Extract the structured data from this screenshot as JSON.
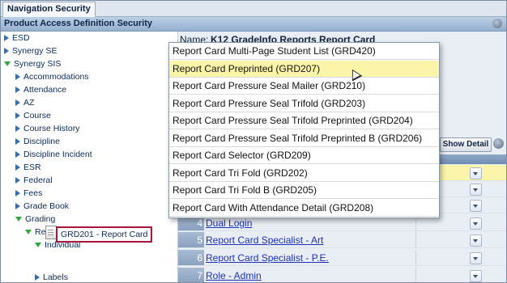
{
  "tab": {
    "label": "Navigation Security"
  },
  "section": {
    "title": "Product Access Definition Security"
  },
  "tree": [
    {
      "label": "ESD",
      "expanded": false
    },
    {
      "label": "Synergy SE",
      "expanded": false
    },
    {
      "label": "Synergy SIS",
      "expanded": true
    },
    {
      "label": "Accommodations",
      "expanded": false
    },
    {
      "label": "Attendance",
      "expanded": false
    },
    {
      "label": "AZ",
      "expanded": false
    },
    {
      "label": "Course",
      "expanded": false
    },
    {
      "label": "Course History",
      "expanded": false
    },
    {
      "label": "Discipline",
      "expanded": false
    },
    {
      "label": "Discipline Incident",
      "expanded": false
    },
    {
      "label": "ESR",
      "expanded": false
    },
    {
      "label": "Federal",
      "expanded": false
    },
    {
      "label": "Fees",
      "expanded": false
    },
    {
      "label": "Grade Book",
      "expanded": false
    },
    {
      "label": "Grading",
      "expanded": true
    },
    {
      "label": "Reports",
      "expanded": true
    },
    {
      "label": "Individual",
      "expanded": true
    },
    {
      "label": "GRD201 - Report Card",
      "selected": true
    },
    {
      "label": "Labels",
      "expanded": false
    }
  ],
  "name_field": {
    "label": "Name:",
    "value": "K12 GradeInfo Reports Report Card"
  },
  "show_detail_label": "Show Detail",
  "dropdown_items": [
    "Report Card Multi-Page Student List (GRD420)",
    "Report Card Preprinted (GRD207)",
    "Report Card Pressure Seal Mailer (GRD210)",
    "Report Card Pressure Seal Trifold (GRD203)",
    "Report Card Pressure Seal Trifold Preprinted (GRD204)",
    "Report Card Pressure Seal Trifold Preprinted B (GRD206)",
    "Report Card Selector (GRD209)",
    "Report Card Tri Fold (GRD202)",
    "Report Card Tri Fold B (GRD205)",
    "Report Card With Attendance Detail (GRD208)"
  ],
  "dropdown_highlighted_index": 1,
  "grid_rows": [
    {
      "num": "",
      "label": ""
    },
    {
      "num": "",
      "label": ""
    },
    {
      "num": "",
      "label": ""
    },
    {
      "num": "4",
      "label": "Dual Login"
    },
    {
      "num": "5",
      "label": "Report Card Specialist - Art"
    },
    {
      "num": "6",
      "label": "Report Card Specialist - P.E."
    },
    {
      "num": "7",
      "label": "Role - Admin"
    }
  ]
}
